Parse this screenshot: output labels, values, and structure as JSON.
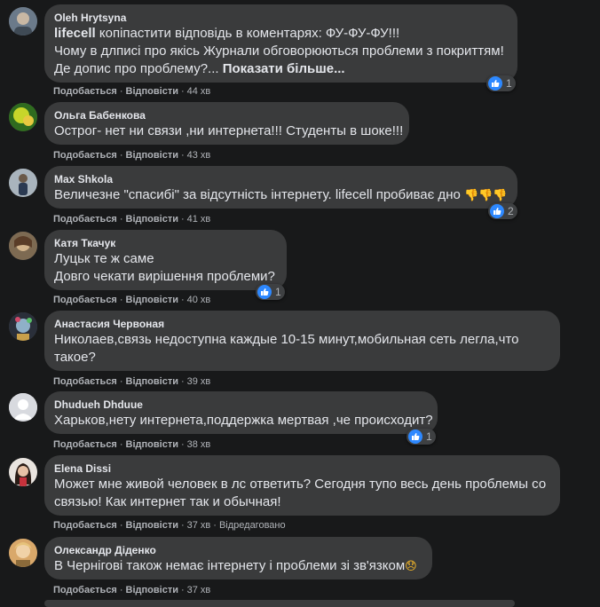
{
  "comments": [
    {
      "author": "Oleh Hrytsyna",
      "line1_bold": "lifecell",
      "line1_rest": " копіпастити відповідь в коментарях: ФУ-ФУ-ФУ!!!",
      "line2": "Чому в длписі про якісь Журнали обговорюються проблеми з покриттям!",
      "line3": "Де допис про проблему?... ",
      "see_more": "Показати більше...",
      "like": "Подобається",
      "reply": "Відповісти",
      "time": "44 хв",
      "reaction_count": "1"
    },
    {
      "author": "Ольга Бабенкова",
      "line1": "Острог- нет ни связи ,ни интернета!!! Студенты в шоке!!!",
      "like": "Подобається",
      "reply": "Відповісти",
      "time": "43 хв"
    },
    {
      "author": "Max Shkola",
      "line1": "Величезне \"спасибі\" за відсутність інтернету. lifecell пробиває дно ",
      "emoji": "👎👎👎",
      "like": "Подобається",
      "reply": "Відповісти",
      "time": "41 хв",
      "reaction_count": "2"
    },
    {
      "author": "Катя Ткачук",
      "line1": "Луцьк те ж саме",
      "line2": "Довго чекати вирішення проблеми?",
      "like": "Подобається",
      "reply": "Відповісти",
      "time": "40 хв",
      "reaction_count": "1"
    },
    {
      "author": "Анастасия Червоная",
      "line1": "Николаев,связь недоступна каждые 10-15 минут,мобильная сеть легла,что",
      "line2": "такое?",
      "like": "Подобається",
      "reply": "Відповісти",
      "time": "39 хв"
    },
    {
      "author": "Dhudueh Dhduue",
      "line1": "Харьков,нету интернета,поддержка мертвая ,че происходит?",
      "like": "Подобається",
      "reply": "Відповісти",
      "time": "38 хв",
      "reaction_count": "1"
    },
    {
      "author": "Elena Dissi",
      "line1": "Может мне живой человек в лс ответить? Сегодня тупо весь день проблемы со",
      "line2": "связью! Как интернет так и обычная!",
      "like": "Подобається",
      "reply": "Відповісти",
      "time": "37 хв",
      "edited": "Відредаговано"
    },
    {
      "author": "Олександр Діденко",
      "line1": "В Чернігові також немає інтернету і проблеми зі зв'язком",
      "emoji": "😞",
      "like": "Подобається",
      "reply": "Відповісти",
      "time": "37 хв"
    }
  ],
  "colors": {
    "background": "#18191a",
    "bubble": "#3a3b3c",
    "text": "#e4e6eb",
    "secondary": "#b0b3b8",
    "like_blue": "#2d88ff"
  }
}
